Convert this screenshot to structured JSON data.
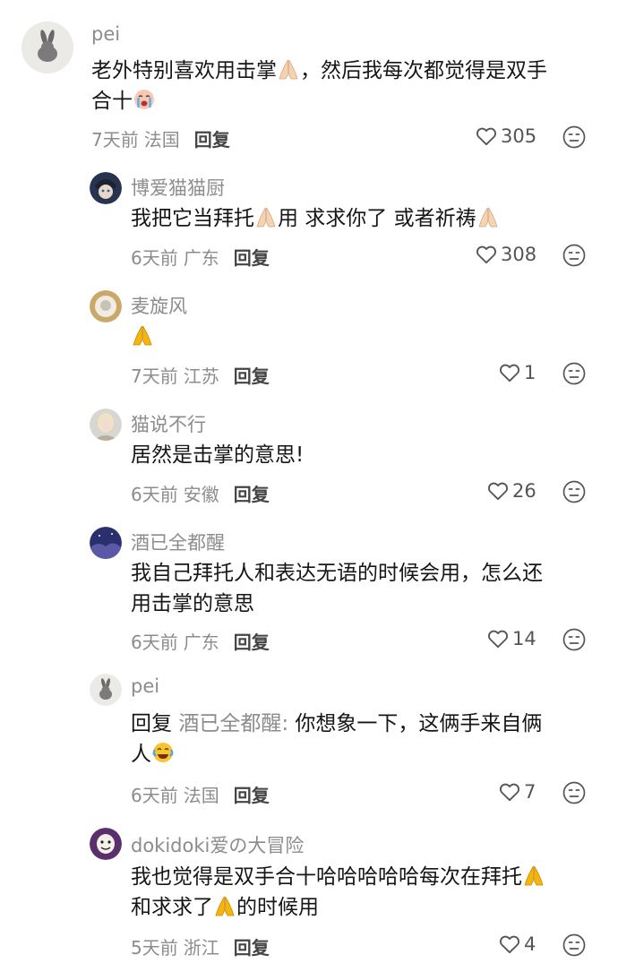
{
  "comments": [
    {
      "username": "pei",
      "text_before": "老外特别喜欢用击掌",
      "text_after": "，然后我每次都觉得是双手",
      "text_line2": "合十",
      "time": "7天前",
      "location": "法国",
      "reply_label": "回复",
      "likes": "305"
    },
    {
      "username": "博爱猫猫厨",
      "text_before": "我把它当拜托",
      "text_mid": "用 求求你了 或者祈祷",
      "time": "6天前",
      "location": "广东",
      "reply_label": "回复",
      "likes": "308"
    },
    {
      "username": "麦旋风",
      "time": "7天前",
      "location": "江苏",
      "reply_label": "回复",
      "likes": "1"
    },
    {
      "username": "猫说不行",
      "text": "居然是击掌的意思!",
      "time": "6天前",
      "location": "安徽",
      "reply_label": "回复",
      "likes": "26"
    },
    {
      "username": "酒已全都醒",
      "text_line1": "我自己拜托人和表达无语的时候会用，怎么还",
      "text_line2": "用击掌的意思",
      "time": "6天前",
      "location": "广东",
      "reply_label": "回复",
      "likes": "14"
    },
    {
      "username": "pei",
      "reply_prefix": "回复",
      "reply_target": "酒已全都醒:",
      "text_line1": "你想象一下，这俩手来自俩",
      "text_line2": "人",
      "time": "6天前",
      "location": "法国",
      "reply_label": "回复",
      "likes": "7"
    },
    {
      "username": "dokidoki爱の大冒险",
      "text_line1": "我也觉得是双手合十哈哈哈哈哈每次在拜托",
      "text_line2a": "和求求了",
      "text_line2b": "的时候用",
      "time": "5天前",
      "location": "浙江",
      "reply_label": "回复",
      "likes": "4"
    }
  ],
  "colors": {
    "muted": "#8c8c8c",
    "text": "#161616",
    "pray_light": "#f3d3b2",
    "pray_yellow": "#f5b50f"
  },
  "icons": [
    "heart-icon",
    "dislike-face-icon",
    "folded-hands-icon",
    "crying-face-icon",
    "tears-of-joy-icon"
  ]
}
